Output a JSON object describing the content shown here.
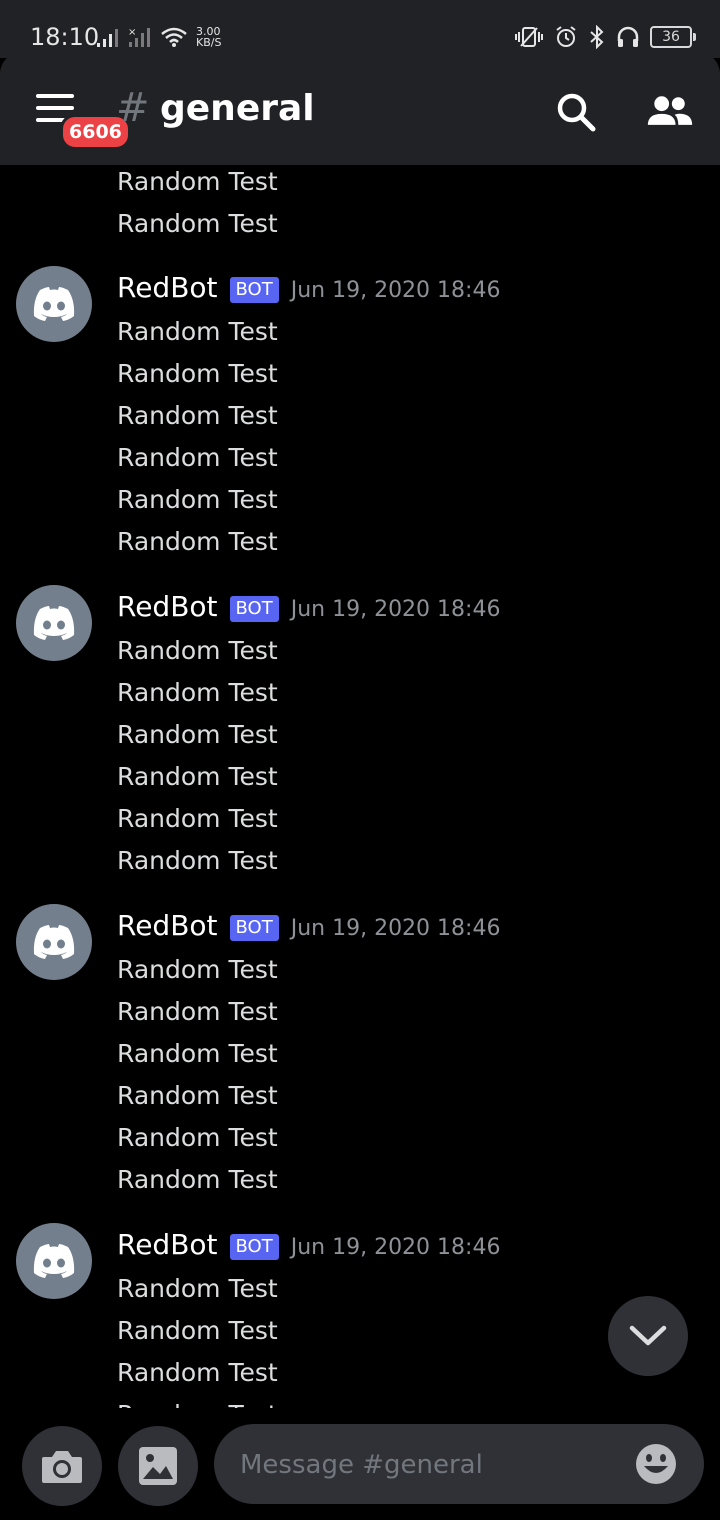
{
  "status_bar": {
    "time": "18:10",
    "speed_value": "3.00",
    "speed_unit": "KB/S",
    "battery": "36",
    "icons": [
      "signal-icon",
      "signal-off-icon",
      "wifi-icon",
      "vibrate-icon",
      "alarm-icon",
      "bluetooth-icon",
      "headphones-icon",
      "battery-icon"
    ]
  },
  "header": {
    "badge_count": "6606",
    "hash": "#",
    "channel_name": "general",
    "icons": [
      "menu-icon",
      "search-icon",
      "members-icon"
    ]
  },
  "messages": {
    "top_continuation": [
      "Random Test",
      "Random Test"
    ],
    "groups": [
      {
        "username": "RedBot",
        "tag": "BOT",
        "timestamp": "Jun 19, 2020 18:46",
        "lines": [
          "Random Test",
          "Random Test",
          "Random Test",
          "Random Test",
          "Random Test",
          "Random Test"
        ]
      },
      {
        "username": "RedBot",
        "tag": "BOT",
        "timestamp": "Jun 19, 2020 18:46",
        "lines": [
          "Random Test",
          "Random Test",
          "Random Test",
          "Random Test",
          "Random Test",
          "Random Test"
        ]
      },
      {
        "username": "RedBot",
        "tag": "BOT",
        "timestamp": "Jun 19, 2020 18:46",
        "lines": [
          "Random Test",
          "Random Test",
          "Random Test",
          "Random Test",
          "Random Test",
          "Random Test"
        ]
      },
      {
        "username": "RedBot",
        "tag": "BOT",
        "timestamp": "Jun 19, 2020 18:46",
        "lines": [
          "Random Test",
          "Random Test",
          "Random Test",
          "Random Test"
        ]
      }
    ]
  },
  "composer": {
    "placeholder": "Message #general",
    "icons": [
      "camera-icon",
      "image-icon",
      "emoji-icon",
      "chevron-down-icon"
    ]
  },
  "colors": {
    "background": "#000000",
    "header": "#202225",
    "bot_tag": "#5865f2",
    "badge": "#ed4245",
    "avatar": "#747f8d"
  }
}
